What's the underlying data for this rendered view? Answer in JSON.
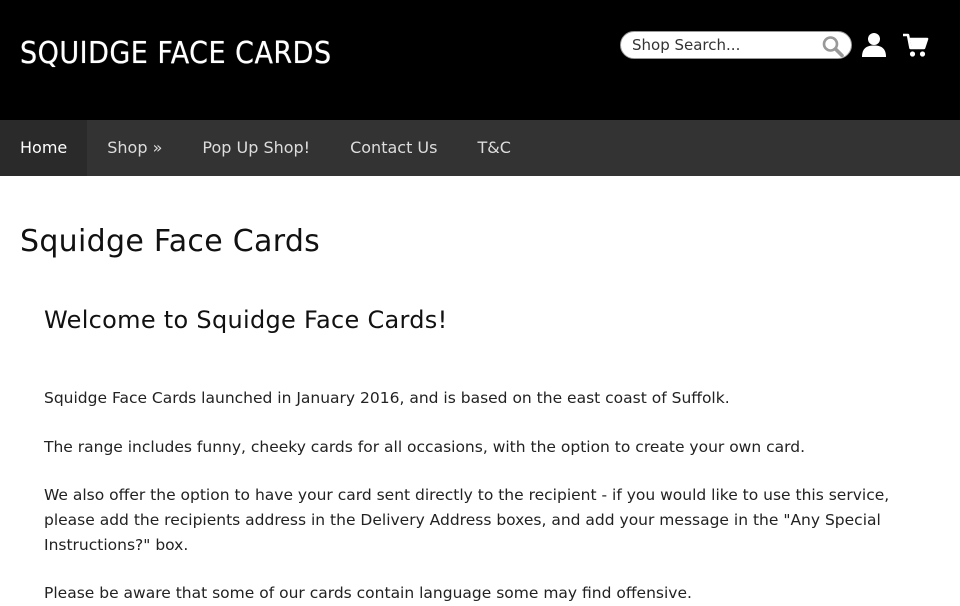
{
  "header": {
    "logo_text": "Squidge Face Cards",
    "search": {
      "placeholder": "Shop Search...",
      "value": ""
    },
    "icons": {
      "search": "magnifier-icon",
      "account": "user-icon",
      "cart": "cart-icon"
    }
  },
  "nav": {
    "items": [
      {
        "label": "Home",
        "active": true
      },
      {
        "label": "Shop »",
        "active": false
      },
      {
        "label": "Pop Up Shop!",
        "active": false
      },
      {
        "label": "Contact Us",
        "active": false
      },
      {
        "label": "T&C",
        "active": false
      }
    ]
  },
  "main": {
    "page_title": "Squidge Face Cards",
    "welcome_heading": "Welcome to Squidge Face Cards!",
    "paragraphs": [
      "Squidge Face Cards launched in January 2016, and is based on the east coast of Suffolk.",
      "The range includes funny, cheeky cards for all occasions, with the option to create your own card.",
      "We also offer the option to have your card sent directly to the recipient - if you would like to use this service, please add the recipients address in the Delivery Address boxes, and add your message in the \"Any Special Instructions?\" box.",
      "Please be aware that some of our cards contain language some may find offensive."
    ]
  },
  "colors": {
    "header_bg": "#000000",
    "nav_bg": "#333333",
    "nav_active_bg": "#2a2a2a",
    "text": "#222222"
  }
}
